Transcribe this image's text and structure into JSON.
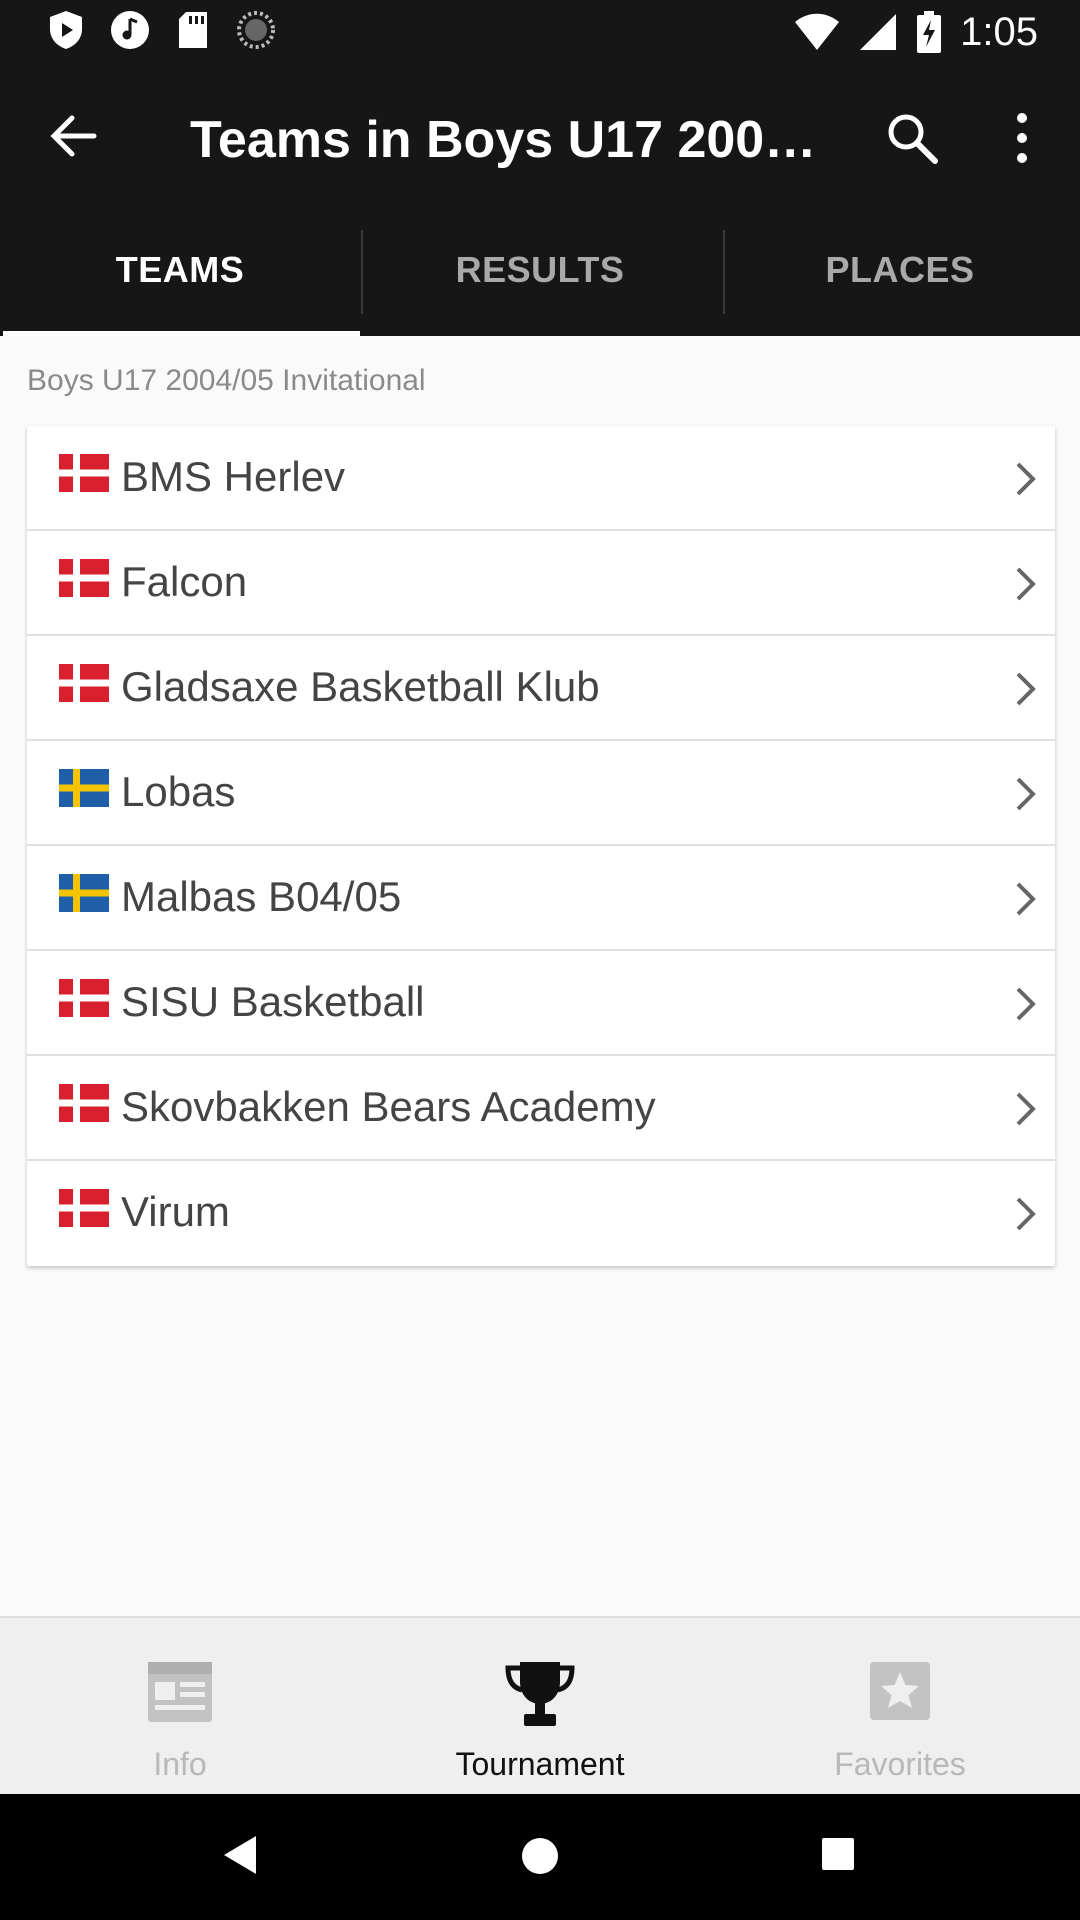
{
  "status_bar": {
    "time": "1:05",
    "icons": [
      "play-protect-icon",
      "music-icon",
      "sd-card-icon",
      "sync-icon",
      "wifi-icon",
      "signal-icon",
      "battery-charging-icon"
    ]
  },
  "app_bar": {
    "title": "Teams in Boys U17 2004…",
    "icons": [
      "back-arrow-icon",
      "search-icon",
      "more-vert-icon"
    ]
  },
  "tabs": [
    {
      "label": "TEAMS",
      "active": true
    },
    {
      "label": "RESULTS",
      "active": false
    },
    {
      "label": "PLACES",
      "active": false
    }
  ],
  "main": {
    "section_label": "Boys U17 2004/05 Invitational",
    "teams": [
      {
        "name": "BMS Herlev",
        "flag": "denmark"
      },
      {
        "name": "Falcon",
        "flag": "denmark"
      },
      {
        "name": "Gladsaxe Basketball Klub",
        "flag": "denmark"
      },
      {
        "name": "Lobas",
        "flag": "sweden"
      },
      {
        "name": "Malbas B04/05",
        "flag": "sweden"
      },
      {
        "name": "SISU Basketball",
        "flag": "denmark"
      },
      {
        "name": "Skovbakken Bears Academy",
        "flag": "denmark"
      },
      {
        "name": "Virum",
        "flag": "denmark"
      }
    ]
  },
  "bottom_nav": [
    {
      "label": "Info",
      "icon": "news-icon",
      "active": false
    },
    {
      "label": "Tournament",
      "icon": "trophy-icon",
      "active": true
    },
    {
      "label": "Favorites",
      "icon": "star-icon",
      "active": false
    }
  ],
  "system_nav": {
    "icons": [
      "back-triangle-icon",
      "home-circle-icon",
      "recents-square-icon"
    ]
  },
  "colors": {
    "bar_background": "#161616",
    "denmark_red": "#d8202e",
    "sweden_blue": "#1f5fa8",
    "sweden_yellow": "#f5c400"
  }
}
